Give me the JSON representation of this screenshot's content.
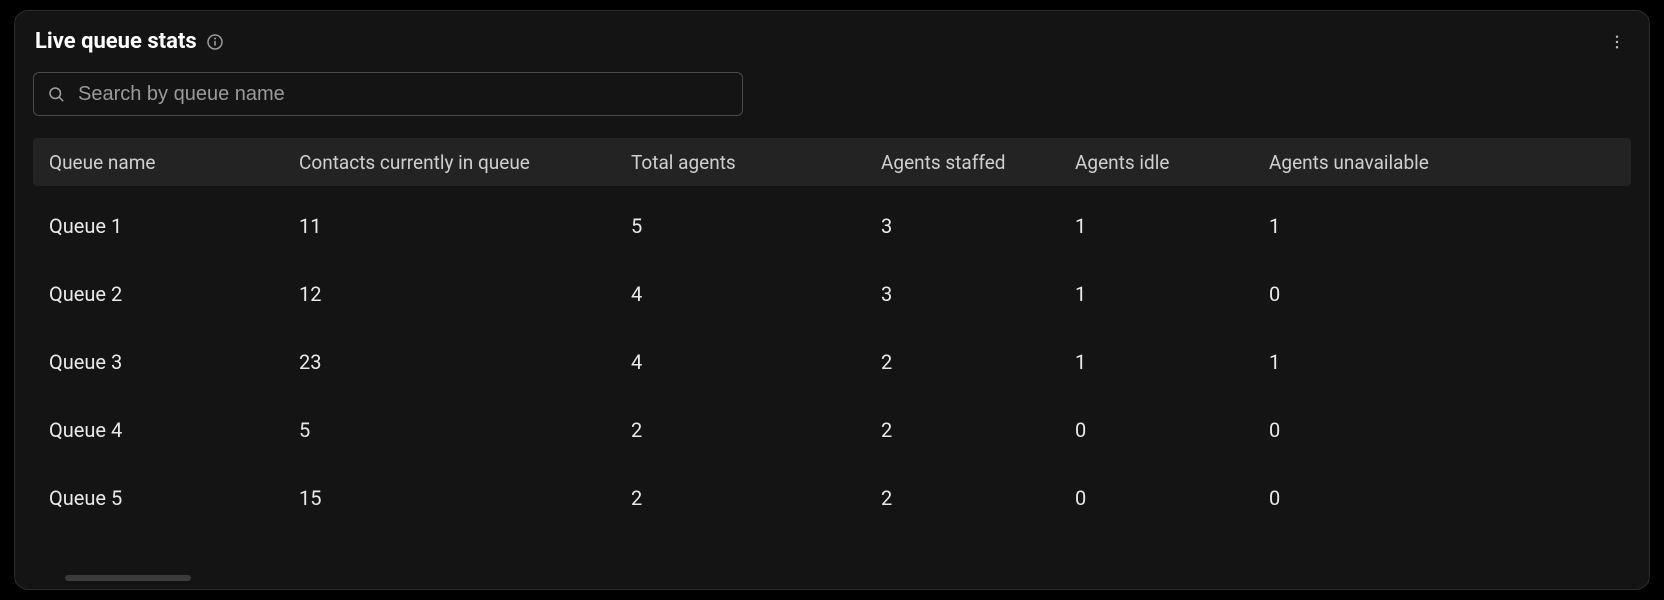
{
  "header": {
    "title": "Live queue stats"
  },
  "search": {
    "placeholder": "Search by queue name"
  },
  "columns": {
    "name": "Queue name",
    "contacts": "Contacts currently in queue",
    "total": "Total agents",
    "staffed": "Agents staffed",
    "idle": "Agents idle",
    "unavailable": "Agents unavailable"
  },
  "rows": [
    {
      "name": "Queue 1",
      "contacts": "11",
      "total": "5",
      "staffed": "3",
      "idle": "1",
      "unavailable": "1"
    },
    {
      "name": "Queue 2",
      "contacts": "12",
      "total": "4",
      "staffed": "3",
      "idle": "1",
      "unavailable": "0"
    },
    {
      "name": "Queue 3",
      "contacts": "23",
      "total": "4",
      "staffed": "2",
      "idle": "1",
      "unavailable": "1"
    },
    {
      "name": "Queue 4",
      "contacts": "5",
      "total": "2",
      "staffed": "2",
      "idle": "0",
      "unavailable": "0"
    },
    {
      "name": "Queue 5",
      "contacts": "15",
      "total": "2",
      "staffed": "2",
      "idle": "0",
      "unavailable": "0"
    }
  ]
}
